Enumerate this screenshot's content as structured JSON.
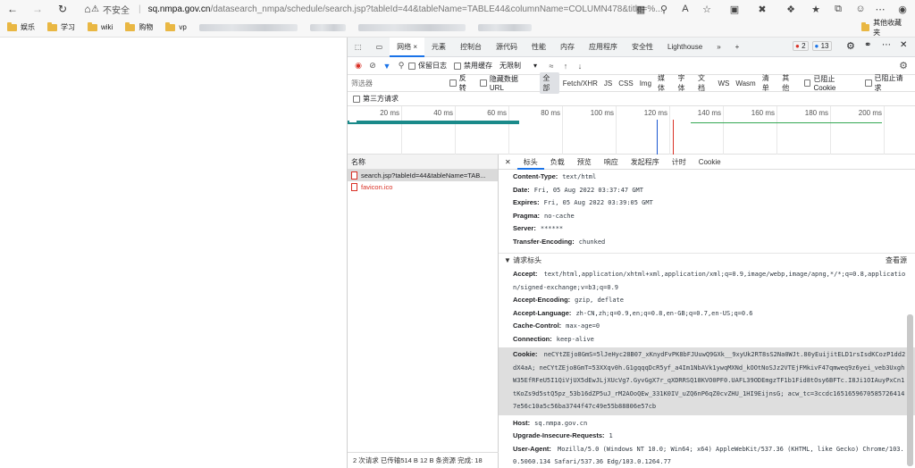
{
  "browser": {
    "security_text": "不安全",
    "url_host": "sq.nmpa.gov.cn",
    "url_path": "/datasearch_nmpa/schedule/search.jsp?tableId=44&tableName=TABLE44&columnName=COLUMN478&title=%...",
    "bookmarks": [
      "娱乐",
      "学习",
      "wiki",
      "购物",
      "vp"
    ],
    "other_bookmarks": "其他收藏夹"
  },
  "devtools": {
    "tabs": [
      "网络",
      "元素",
      "控制台",
      "源代码",
      "性能",
      "内存",
      "应用程序",
      "安全性",
      "Lighthouse"
    ],
    "errors_count": "2",
    "messages_count": "13",
    "toolbar": {
      "preserve_log": "保留日志",
      "disable_cache": "禁用缓存",
      "throttle": "无限制"
    },
    "filter": {
      "placeholder": "筛选器",
      "invert": "反转",
      "hide_data_url": "隐藏数据 URL",
      "types": [
        "全部",
        "Fetch/XHR",
        "JS",
        "CSS",
        "Img",
        "媒体",
        "字体",
        "文档",
        "WS",
        "Wasm",
        "清单",
        "其他"
      ],
      "blocked_cookies": "已阻止 Cookie",
      "blocked_requests": "已阻止请求",
      "third_party": "第三方请求"
    },
    "timeline_ticks": [
      "20 ms",
      "40 ms",
      "60 ms",
      "80 ms",
      "100 ms",
      "120 ms",
      "140 ms",
      "160 ms",
      "180 ms",
      "200 ms"
    ],
    "requests_header": "名称",
    "requests": [
      "search.jsp?tableId=44&tableName=TAB...",
      "favicon.ico"
    ],
    "status_bar": "2 次请求  已传输514 B  12 B 条资源  完成: 18",
    "detail_tabs": [
      "标头",
      "负载",
      "预览",
      "响应",
      "发起程序",
      "计时",
      "Cookie"
    ],
    "response_headers": [
      {
        "k": "Content-Type:",
        "v": "text/html"
      },
      {
        "k": "Date:",
        "v": "Fri, 05 Aug 2022 03:37:47 GMT"
      },
      {
        "k": "Expires:",
        "v": "Fri, 05 Aug 2022 03:39:05 GMT"
      },
      {
        "k": "Pragma:",
        "v": "no-cache"
      },
      {
        "k": "Server:",
        "v": "******"
      },
      {
        "k": "Transfer-Encoding:",
        "v": "chunked"
      }
    ],
    "request_section": "▼ 请求标头",
    "view_source": "查看源",
    "request_headers": [
      {
        "k": "Accept:",
        "v": "text/html,application/xhtml+xml,application/xml;q=0.9,image/webp,image/apng,*/*;q=0.8,application/signed-exchange;v=b3;q=0.9"
      },
      {
        "k": "Accept-Encoding:",
        "v": "gzip, deflate"
      },
      {
        "k": "Accept-Language:",
        "v": "zh-CN,zh;q=0.9,en;q=0.8,en-GB;q=0.7,en-US;q=0.6"
      },
      {
        "k": "Cache-Control:",
        "v": "max-age=0"
      },
      {
        "k": "Connection:",
        "v": "keep-alive"
      },
      {
        "k": "Cookie:",
        "v": "neCYtZEjo8GmS=5lJeHyc28B07_xKnydFvPK8bFJUuwQ9GXk__9xyUk2RT8sS2Na0WJt.80yEuijitELD1rsIsdKCozP1dd2dX4aA; neCYtZEjo8GmT=53XXqv0h.G1gqqqDcR5yf_a4Im1NbAVk1ywqMXNd_kOOtNoSJz2VTEjFMkivF47qmweq9z6yei_veb3UxghW35EfRFeU5I1QiVjUX5dEwJLjXUcVg7.GyvGgX7r_qXDRRSQ18KVO0PF0.UAFL39ODEmgzTF1b1Fid8tOsy6BFTc.I8Ji1OIAuyPxCn1tKoZs9d5stQ5pz_53b16dZP5uJ_rM2AOoQEw_331K0IV_uZQ6nP6qZ0cvZHU_1HI9EijnsG; acw_tc=3ccdc16516596705857264147e56c10a5c56ba3744f47c49e55b88806e57cb"
      },
      {
        "k": "Host:",
        "v": "sq.nmpa.gov.cn"
      },
      {
        "k": "Upgrade-Insecure-Requests:",
        "v": "1"
      },
      {
        "k": "User-Agent:",
        "v": "Mozilla/5.0 (Windows NT 10.0; Win64; x64) AppleWebKit/537.36 (KHTML, like Gecko) Chrome/103.0.5060.134 Safari/537.36 Edg/103.0.1264.77"
      }
    ]
  }
}
